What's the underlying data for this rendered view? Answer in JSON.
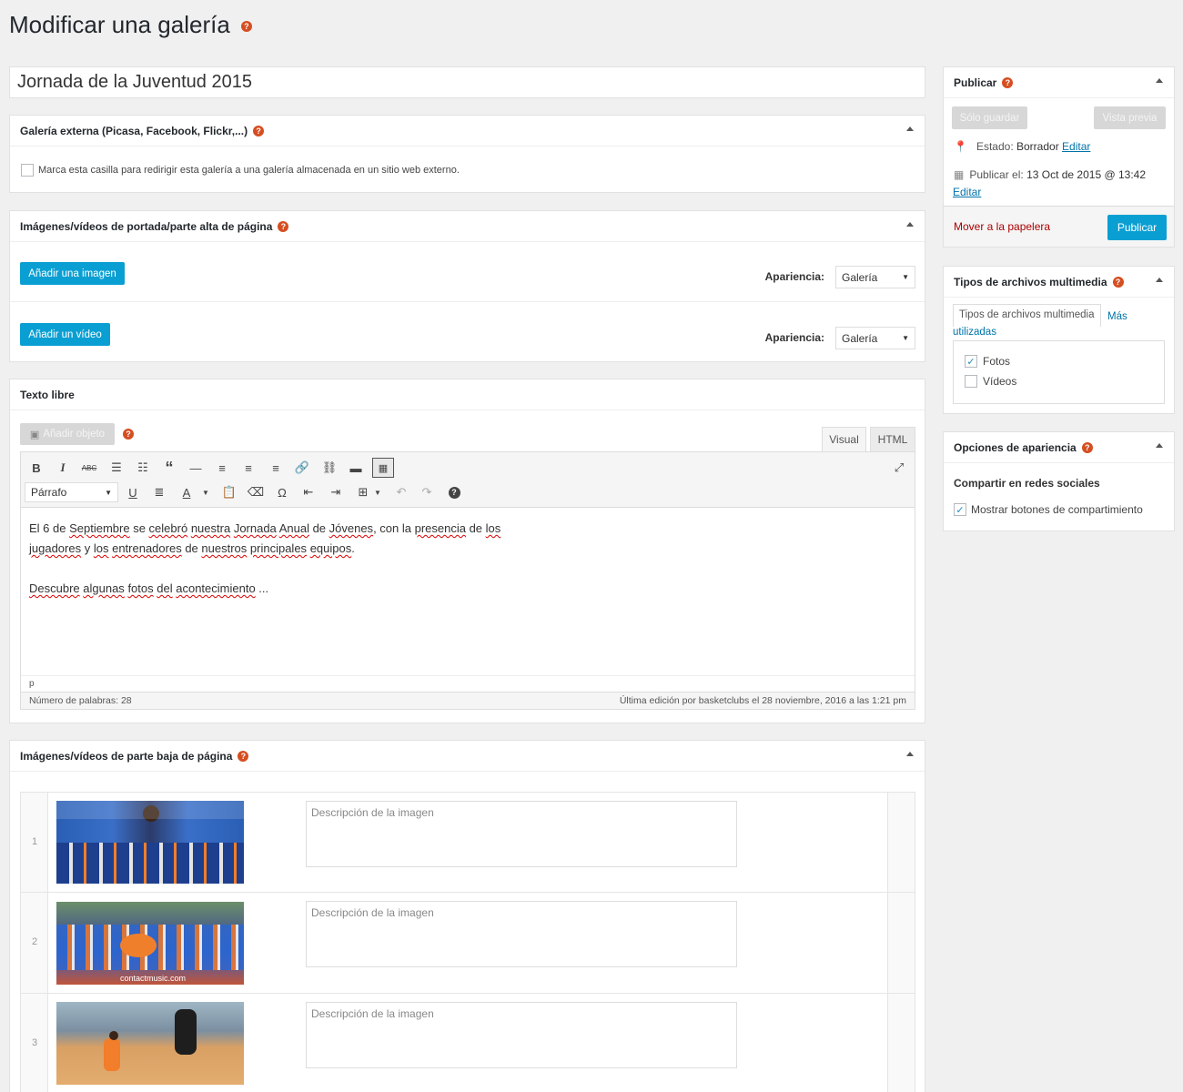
{
  "page": {
    "title": "Modificar una galería"
  },
  "title_field": {
    "value": "Jornada de la Juventud 2015"
  },
  "external": {
    "title": "Galería externa (Picasa, Facebook, Flickr,...)",
    "checkbox_label": "Marca esta casilla para redirigir esta galería a una galería almacenada en un sitio web externo."
  },
  "top_media": {
    "title": "Imágenes/vídeos de portada/parte alta de página",
    "add_image": "Añadir una imagen",
    "add_video": "Añadir un vídeo",
    "appearance_label": "Apariencia:",
    "appearance_value": "Galería"
  },
  "editor": {
    "title": "Texto libre",
    "add_object": "Añadir objeto",
    "tab_visual": "Visual",
    "tab_html": "HTML",
    "format": "Párrafo",
    "content": {
      "l1": [
        "El 6 de ",
        "Septiembre",
        " se ",
        "celebró",
        " ",
        "nuestra",
        " ",
        "Jornada",
        " ",
        "Anual",
        " de ",
        "Jóvenes",
        ", con la ",
        "presencia",
        " de ",
        "los"
      ],
      "l2": [
        "jugadores",
        " y ",
        "los",
        " ",
        "entrenadores",
        " de ",
        "nuestros",
        " ",
        "principales",
        " ",
        "equipos",
        "."
      ],
      "l3": [
        "Descubre",
        " ",
        "algunas",
        " ",
        "fotos",
        " ",
        "del",
        " ",
        "acontecimiento",
        " ..."
      ]
    },
    "path": "p",
    "word_count": "Número de palabras: 28",
    "last_edit": "Última edición por basketclubs el 28 noviembre, 2016 a las 1:21 pm"
  },
  "bottom_media": {
    "title": "Imágenes/vídeos de parte baja de página",
    "rows": [
      {
        "num": "1",
        "placeholder": "Descripción de la imagen"
      },
      {
        "num": "2",
        "placeholder": "Descripción de la imagen"
      },
      {
        "num": "3",
        "placeholder": "Descripción de la imagen"
      }
    ],
    "watermark": "contactmusic.com"
  },
  "publish": {
    "title": "Publicar",
    "save": "Sólo guardar",
    "preview": "Vista previa",
    "status_label": "Estado:",
    "status_value": "Borrador",
    "edit": "Editar",
    "publish_label": "Publicar el:",
    "publish_date": "13 Oct de 2015 @ 13:42",
    "trash": "Mover a la papelera",
    "publish_button": "Publicar"
  },
  "media_types": {
    "title": "Tipos de archivos multimedia",
    "tab_all": "Tipos de archivos multimedia",
    "tab_more": "Más utilizadas",
    "items": [
      {
        "label": "Fotos",
        "checked": true
      },
      {
        "label": "Vídeos",
        "checked": false
      }
    ]
  },
  "appearance": {
    "title": "Opciones de apariencia",
    "subtitle": "Compartir en redes sociales",
    "checkbox": "Mostrar botones de compartimiento"
  },
  "colors": {
    "accent": "#0a9fd3",
    "help": "#d54e21",
    "trash": "#a00",
    "link": "#0073aa"
  }
}
